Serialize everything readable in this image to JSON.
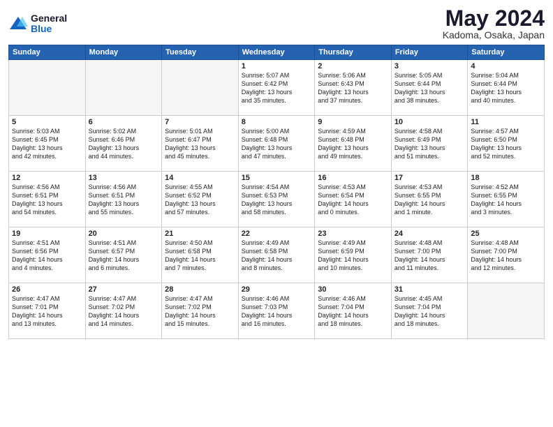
{
  "logo": {
    "general": "General",
    "blue": "Blue"
  },
  "title": "May 2024",
  "location": "Kadoma, Osaka, Japan",
  "headers": [
    "Sunday",
    "Monday",
    "Tuesday",
    "Wednesday",
    "Thursday",
    "Friday",
    "Saturday"
  ],
  "weeks": [
    [
      {
        "day": "",
        "text": ""
      },
      {
        "day": "",
        "text": ""
      },
      {
        "day": "",
        "text": ""
      },
      {
        "day": "1",
        "text": "Sunrise: 5:07 AM\nSunset: 6:42 PM\nDaylight: 13 hours\nand 35 minutes."
      },
      {
        "day": "2",
        "text": "Sunrise: 5:06 AM\nSunset: 6:43 PM\nDaylight: 13 hours\nand 37 minutes."
      },
      {
        "day": "3",
        "text": "Sunrise: 5:05 AM\nSunset: 6:44 PM\nDaylight: 13 hours\nand 38 minutes."
      },
      {
        "day": "4",
        "text": "Sunrise: 5:04 AM\nSunset: 6:44 PM\nDaylight: 13 hours\nand 40 minutes."
      }
    ],
    [
      {
        "day": "5",
        "text": "Sunrise: 5:03 AM\nSunset: 6:45 PM\nDaylight: 13 hours\nand 42 minutes."
      },
      {
        "day": "6",
        "text": "Sunrise: 5:02 AM\nSunset: 6:46 PM\nDaylight: 13 hours\nand 44 minutes."
      },
      {
        "day": "7",
        "text": "Sunrise: 5:01 AM\nSunset: 6:47 PM\nDaylight: 13 hours\nand 45 minutes."
      },
      {
        "day": "8",
        "text": "Sunrise: 5:00 AM\nSunset: 6:48 PM\nDaylight: 13 hours\nand 47 minutes."
      },
      {
        "day": "9",
        "text": "Sunrise: 4:59 AM\nSunset: 6:48 PM\nDaylight: 13 hours\nand 49 minutes."
      },
      {
        "day": "10",
        "text": "Sunrise: 4:58 AM\nSunset: 6:49 PM\nDaylight: 13 hours\nand 51 minutes."
      },
      {
        "day": "11",
        "text": "Sunrise: 4:57 AM\nSunset: 6:50 PM\nDaylight: 13 hours\nand 52 minutes."
      }
    ],
    [
      {
        "day": "12",
        "text": "Sunrise: 4:56 AM\nSunset: 6:51 PM\nDaylight: 13 hours\nand 54 minutes."
      },
      {
        "day": "13",
        "text": "Sunrise: 4:56 AM\nSunset: 6:51 PM\nDaylight: 13 hours\nand 55 minutes."
      },
      {
        "day": "14",
        "text": "Sunrise: 4:55 AM\nSunset: 6:52 PM\nDaylight: 13 hours\nand 57 minutes."
      },
      {
        "day": "15",
        "text": "Sunrise: 4:54 AM\nSunset: 6:53 PM\nDaylight: 13 hours\nand 58 minutes."
      },
      {
        "day": "16",
        "text": "Sunrise: 4:53 AM\nSunset: 6:54 PM\nDaylight: 14 hours\nand 0 minutes."
      },
      {
        "day": "17",
        "text": "Sunrise: 4:53 AM\nSunset: 6:55 PM\nDaylight: 14 hours\nand 1 minute."
      },
      {
        "day": "18",
        "text": "Sunrise: 4:52 AM\nSunset: 6:55 PM\nDaylight: 14 hours\nand 3 minutes."
      }
    ],
    [
      {
        "day": "19",
        "text": "Sunrise: 4:51 AM\nSunset: 6:56 PM\nDaylight: 14 hours\nand 4 minutes."
      },
      {
        "day": "20",
        "text": "Sunrise: 4:51 AM\nSunset: 6:57 PM\nDaylight: 14 hours\nand 6 minutes."
      },
      {
        "day": "21",
        "text": "Sunrise: 4:50 AM\nSunset: 6:58 PM\nDaylight: 14 hours\nand 7 minutes."
      },
      {
        "day": "22",
        "text": "Sunrise: 4:49 AM\nSunset: 6:58 PM\nDaylight: 14 hours\nand 8 minutes."
      },
      {
        "day": "23",
        "text": "Sunrise: 4:49 AM\nSunset: 6:59 PM\nDaylight: 14 hours\nand 10 minutes."
      },
      {
        "day": "24",
        "text": "Sunrise: 4:48 AM\nSunset: 7:00 PM\nDaylight: 14 hours\nand 11 minutes."
      },
      {
        "day": "25",
        "text": "Sunrise: 4:48 AM\nSunset: 7:00 PM\nDaylight: 14 hours\nand 12 minutes."
      }
    ],
    [
      {
        "day": "26",
        "text": "Sunrise: 4:47 AM\nSunset: 7:01 PM\nDaylight: 14 hours\nand 13 minutes."
      },
      {
        "day": "27",
        "text": "Sunrise: 4:47 AM\nSunset: 7:02 PM\nDaylight: 14 hours\nand 14 minutes."
      },
      {
        "day": "28",
        "text": "Sunrise: 4:47 AM\nSunset: 7:02 PM\nDaylight: 14 hours\nand 15 minutes."
      },
      {
        "day": "29",
        "text": "Sunrise: 4:46 AM\nSunset: 7:03 PM\nDaylight: 14 hours\nand 16 minutes."
      },
      {
        "day": "30",
        "text": "Sunrise: 4:46 AM\nSunset: 7:04 PM\nDaylight: 14 hours\nand 18 minutes."
      },
      {
        "day": "31",
        "text": "Sunrise: 4:45 AM\nSunset: 7:04 PM\nDaylight: 14 hours\nand 18 minutes."
      },
      {
        "day": "",
        "text": ""
      }
    ]
  ]
}
